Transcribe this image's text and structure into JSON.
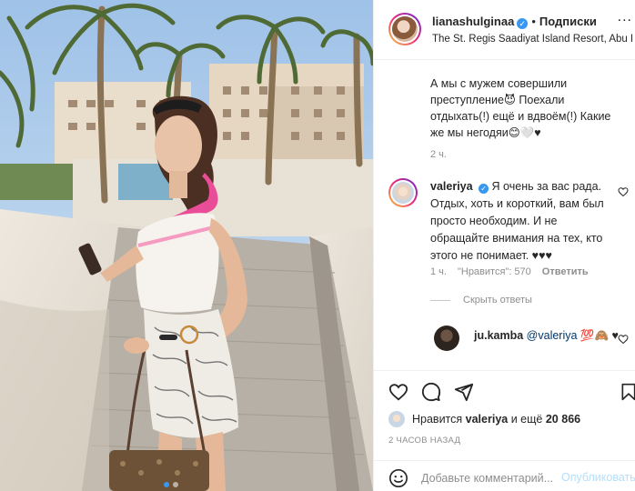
{
  "post": {
    "username": "lianashulginaa",
    "verified_mark": "✓",
    "separator": "•",
    "follow_label": "Подписки",
    "location": "The St. Regis Saadiyat Island Resort, Abu Dhabi",
    "more_label": "...",
    "caption": "А мы с мужем совершили преступление😈 Поехали отдыхать(!) ещё и вдвоём(!) Какие же мы негодяи😊🤍♥",
    "caption_time": "2 ч."
  },
  "comments": [
    {
      "username": "valeriya",
      "verified_mark": "✓",
      "text": "Я очень за вас рада. Отдых, хоть и короткий, вам был просто необходим. И не обращайте внимания на тех, кто этого не понимает. ♥♥♥",
      "time": "1 ч.",
      "likes": "\"Нравится\": 570",
      "reply_label": "Ответить",
      "hide_replies_label": "Скрыть ответы",
      "replies": [
        {
          "username": "ju.kamba",
          "mention": "@valeriya",
          "text": "💯🙈 ♥"
        }
      ]
    }
  ],
  "actions": {
    "icons": [
      "heart-icon",
      "comment-icon",
      "share-icon",
      "bookmark-icon"
    ],
    "likes_prefix": "Нравится",
    "likes_user": "valeriya",
    "likes_middle": "и ещё",
    "likes_count": "20 866",
    "post_time": "2 ЧАСОВ НАЗАД"
  },
  "comment_box": {
    "placeholder": "Добавьте комментарий...",
    "publish_label": "Опубликовать"
  },
  "colors": {
    "link": "#00376b",
    "verified": "#3897f0",
    "publish_disabled": "#b2dffc",
    "muted": "#8e8e8e"
  },
  "carousel": {
    "count": 2,
    "active_index": 0
  }
}
